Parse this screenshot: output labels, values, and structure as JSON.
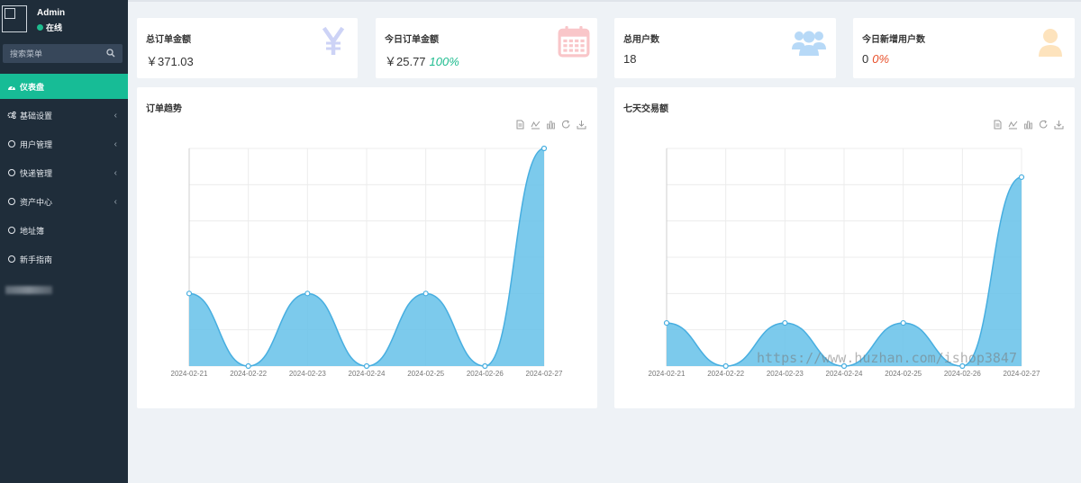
{
  "user": {
    "name": "Admin",
    "status": "在线"
  },
  "search": {
    "placeholder": "搜索菜单"
  },
  "menu": [
    {
      "label": "仪表盘",
      "icon": "dashboard-icon",
      "active": true,
      "has_children": false
    },
    {
      "label": "基础设置",
      "icon": "cogs-icon",
      "active": false,
      "has_children": true
    },
    {
      "label": "用户管理",
      "icon": "circle-icon",
      "active": false,
      "has_children": true
    },
    {
      "label": "快递管理",
      "icon": "circle-icon",
      "active": false,
      "has_children": true
    },
    {
      "label": "资产中心",
      "icon": "circle-icon",
      "active": false,
      "has_children": true
    },
    {
      "label": "地址簿",
      "icon": "circle-icon",
      "active": false,
      "has_children": false
    },
    {
      "label": "新手指南",
      "icon": "circle-icon",
      "active": false,
      "has_children": false
    }
  ],
  "stats": [
    {
      "title": "总订单金额",
      "value": "￥371.03",
      "extra": "",
      "icon": "yen-icon",
      "icon_color": "#cdd3f6"
    },
    {
      "title": "今日订单金额",
      "value": "￥25.77",
      "extra": "100%",
      "extra_color": "#1ebc8f",
      "icon": "calendar-icon",
      "icon_color": "#f9c6c9"
    },
    {
      "title": "总用户数",
      "value": "18",
      "extra": "",
      "icon": "users-icon",
      "icon_color": "#b7d9f7"
    },
    {
      "title": "今日新增用户数",
      "value": "0",
      "extra": "0%",
      "extra_color": "#e8502b",
      "icon": "user-icon",
      "icon_color": "#fde3bd"
    }
  ],
  "chart_data": [
    {
      "type": "area",
      "title": "订单趋势",
      "categories": [
        "2024-02-21",
        "2024-02-22",
        "2024-02-23",
        "2024-02-24",
        "2024-02-25",
        "2024-02-26",
        "2024-02-27"
      ],
      "series": [
        {
          "values": [
            2,
            0,
            2,
            0,
            2,
            0,
            6
          ]
        }
      ],
      "ylim": [
        0,
        6
      ],
      "grid": true,
      "color": "#6ec4ea",
      "line_color": "#47aee0"
    },
    {
      "type": "area",
      "title": "七天交易额",
      "categories": [
        "2024-02-21",
        "2024-02-22",
        "2024-02-23",
        "2024-02-24",
        "2024-02-25",
        "2024-02-26",
        "2024-02-27"
      ],
      "series": [
        {
          "values": [
            49.5,
            0,
            49.5,
            0,
            49.5,
            0,
            217
          ]
        }
      ],
      "ylim": [
        0,
        250
      ],
      "grid": true,
      "color": "#6ec4ea",
      "line_color": "#47aee0"
    }
  ],
  "watermark": "https://www.huzhan.com/ishop3847",
  "colors": {
    "sidebar": "#1f2d3a",
    "accent": "#17bc96",
    "background": "#eef2f6"
  }
}
